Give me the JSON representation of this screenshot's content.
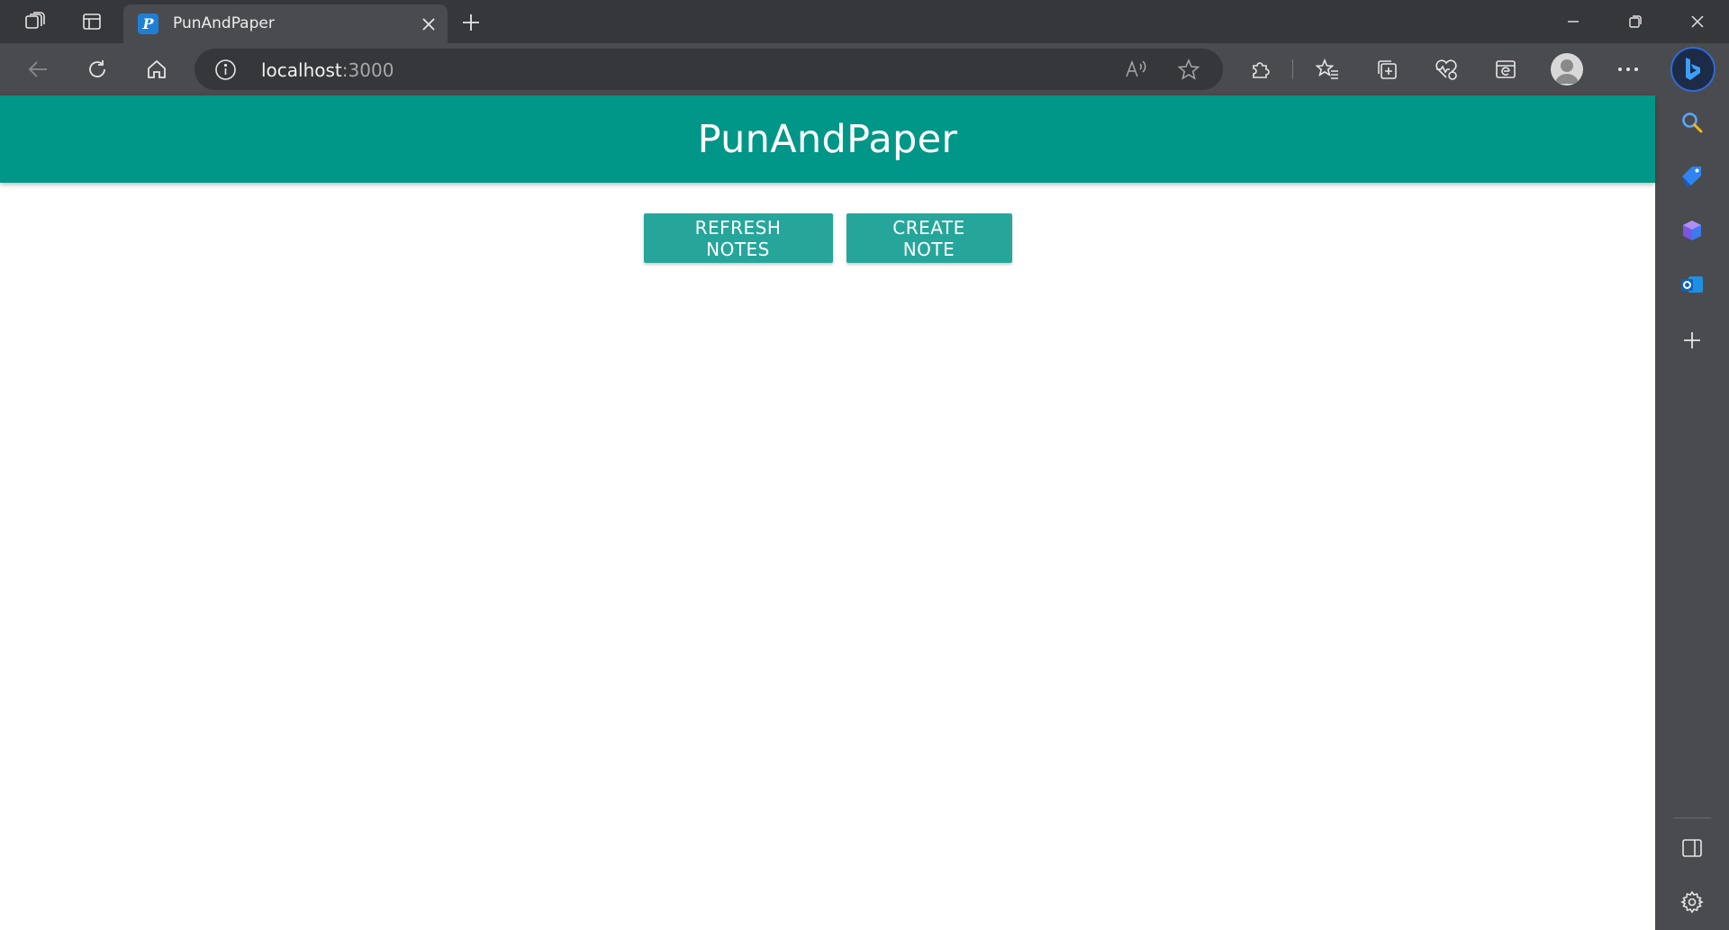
{
  "browser": {
    "tab": {
      "title": "PunAndPaper",
      "favicon_letter": "P"
    },
    "address": {
      "host": "localhost",
      "port": ":3000"
    },
    "icons": {
      "workspaces": "workspaces-icon",
      "tab_actions": "vertical-tabs-icon",
      "close_tab": "close-icon",
      "new_tab": "plus-icon",
      "back": "back-arrow-icon",
      "refresh": "refresh-icon",
      "home": "home-icon",
      "site_info": "info-icon",
      "read_aloud": "read-aloud-icon",
      "favorite": "star-icon",
      "extensions": "puzzle-icon",
      "favorites": "favorites-icon",
      "collections": "collections-icon",
      "health": "browser-essentials-icon",
      "ie_mode": "ie-mode-icon",
      "profile": "profile-avatar",
      "menu": "more-icon",
      "copilot": "bing-icon"
    },
    "sidebar": [
      "search-icon",
      "shopping-tag-icon",
      "games-icon",
      "outlook-icon",
      "add-icon",
      "sidebar-layout-icon",
      "settings-icon"
    ]
  },
  "app": {
    "title": "PunAndPaper",
    "buttons": {
      "refresh": "REFRESH NOTES",
      "create": "CREATE NOTE"
    },
    "colors": {
      "header": "#009688",
      "button": "#26a69a"
    }
  }
}
